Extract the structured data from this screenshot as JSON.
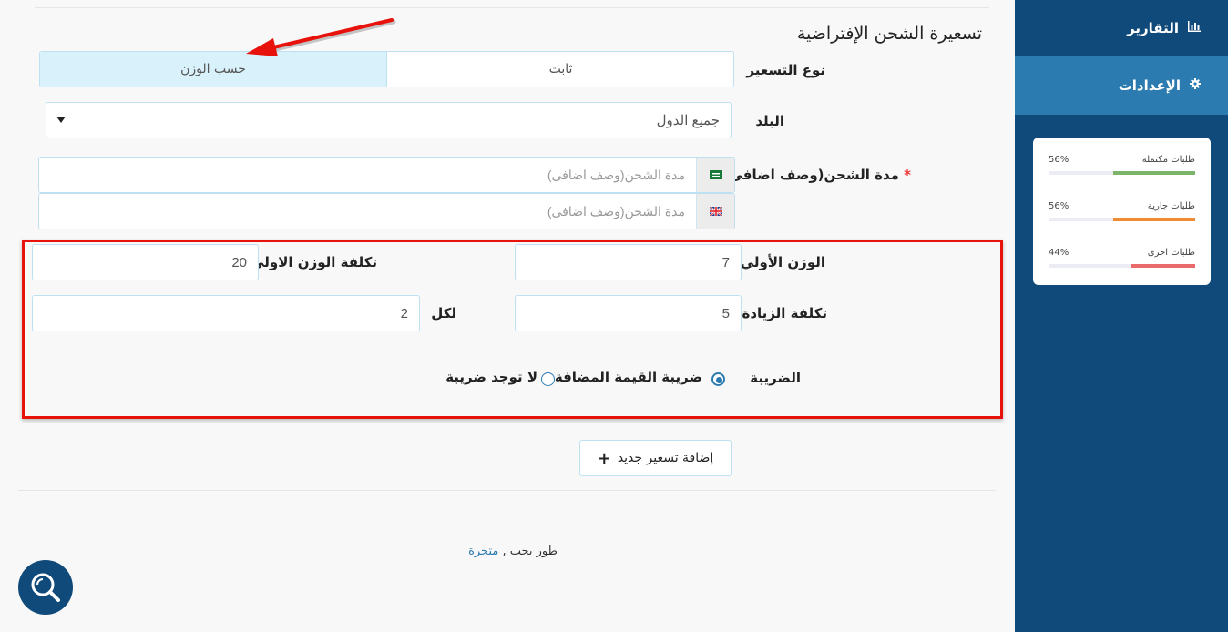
{
  "sidebar": {
    "reports_label": "التقارير",
    "settings_label": "الإعدادات",
    "stats": [
      {
        "label": "طلبات مكتملة",
        "percent_text": "56%",
        "percent": 56,
        "color": "#7cb46b"
      },
      {
        "label": "طلبات جارية",
        "percent_text": "56%",
        "percent": 56,
        "color": "#f08a34"
      },
      {
        "label": "طلبات اخرى",
        "percent_text": "44%",
        "percent": 44,
        "color": "#e86a6a"
      }
    ]
  },
  "form": {
    "title": "تسعيرة الشحن الإفتراضية",
    "pricing_type_label": "نوع التسعير",
    "pricing_type_options": [
      "ثابت",
      "حسب الوزن"
    ],
    "country_label": "البلد",
    "country_value": "جميع الدول",
    "duration_label": "مدة الشحن(وصف اضافى)",
    "required_mark": "*",
    "duration_placeholder_ar": "مدة الشحن(وصف اضافى)",
    "duration_placeholder_en": "مدة الشحن(وصف اضافى)",
    "first_weight_label": "الوزن الأولي",
    "first_weight_value": "7",
    "first_weight_cost_label": "تكلفة الوزن الاولي",
    "first_weight_cost_value": "20",
    "increment_cost_label": "تكلفة الزيادة",
    "increment_cost_value": "5",
    "per_label": "لكل",
    "per_value": "2",
    "tax_label": "الضريبة",
    "tax_options": [
      "ضريبة القيمة المضافة",
      "لا توجد ضريبة"
    ],
    "add_pricing_label": "إضافة تسعير جديد",
    "add_icon": "+"
  },
  "footer": {
    "text": "طور بحب ,",
    "link": "متجرة"
  },
  "colors": {
    "sidebar_bg": "#0f4a7a",
    "sidebar_active": "#2b7bb0",
    "annotation_red": "#e8120c",
    "selected_segment": "#d8f1fb"
  }
}
